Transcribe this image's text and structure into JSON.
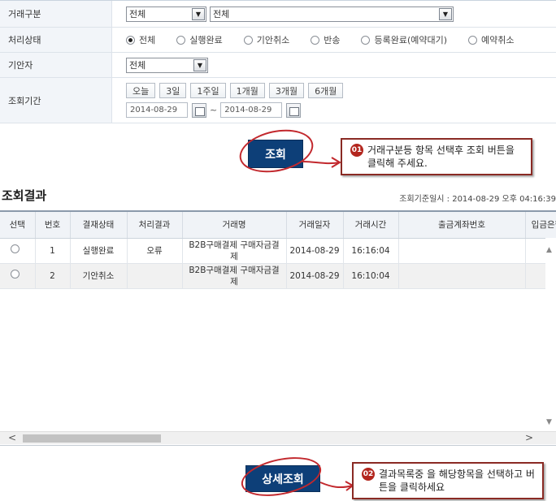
{
  "form": {
    "type_label": "거래구분",
    "type_select1": "전체",
    "type_select2": "전체",
    "status_label": "처리상태",
    "status_options": [
      "전체",
      "실행완료",
      "기안취소",
      "반송",
      "등록완료(예약대기)",
      "예약취소"
    ],
    "status_selected": "전체",
    "drafter_label": "기안자",
    "drafter_select": "전체",
    "period_label": "조회기간",
    "period_buttons": [
      "오늘",
      "3일",
      "1주일",
      "1개월",
      "3개월",
      "6개월"
    ],
    "date_from": "2014-08-29",
    "date_to": "2014-08-29",
    "tilde": "~"
  },
  "search_button": "조회",
  "callout1": {
    "num": "01",
    "text": "거래구분등 항목 선택후 조회 버튼을 클릭해 주세요."
  },
  "results": {
    "title": "조회결과",
    "date_info": "조회기준일시 : 2014-08-29 오후 04:16:39",
    "columns": [
      "선택",
      "번호",
      "결재상태",
      "처리결과",
      "거래명",
      "거래일자",
      "거래시간",
      "출금계좌번호",
      "입금은행"
    ],
    "rows": [
      {
        "no": "1",
        "approval": "실행완료",
        "result": "오류",
        "name": "B2B구매결제 구매자금결제",
        "date": "2014-08-29",
        "time": "16:16:04",
        "account": "",
        "bank": ""
      },
      {
        "no": "2",
        "approval": "기안취소",
        "result": "",
        "name": "B2B구매결제 구매자금결제",
        "date": "2014-08-29",
        "time": "16:10:04",
        "account": "",
        "bank": ""
      }
    ]
  },
  "detail_button": "상세조회",
  "callout2": {
    "num": "02",
    "text": "결과목록중 을 해당항목을 선택하고 버튼을 클릭하세요"
  },
  "colors": {
    "primary_button": "#0d3f78",
    "callout_border": "#8a2a24",
    "highlight_ring": "#c2282d"
  }
}
